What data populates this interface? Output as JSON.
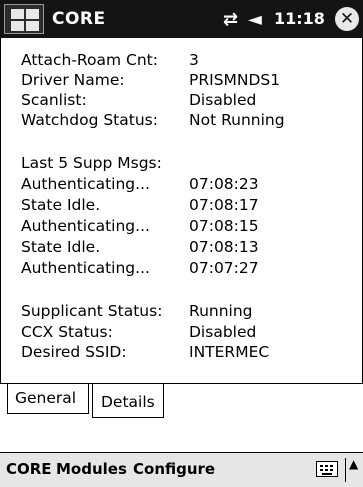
{
  "titlebar": {
    "title": "CORE",
    "time": "11:18",
    "icons": [
      "start-menu-icon",
      "connectivity-icon",
      "volume-icon",
      "close-icon"
    ]
  },
  "details": {
    "rows": [
      {
        "label": "Attach-Roam Cnt:",
        "value": "3"
      },
      {
        "label": "Driver Name:",
        "value": "PRISMNDS1"
      },
      {
        "label": "Scanlist:",
        "value": "Disabled"
      },
      {
        "label": "Watchdog Status:",
        "value": "Not Running"
      },
      {
        "label": "Last 5 Supp Msgs:",
        "value": ""
      },
      {
        "label": "Authenticating...",
        "value": "07:08:23"
      },
      {
        "label": "State Idle.",
        "value": "07:08:17"
      },
      {
        "label": "Authenticating...",
        "value": "07:08:15"
      },
      {
        "label": "State Idle.",
        "value": "07:08:13"
      },
      {
        "label": "Authenticating...",
        "value": "07:07:27"
      },
      {
        "label": "Supplicant Status:",
        "value": "Running"
      },
      {
        "label": "CCX Status:",
        "value": "Disabled"
      },
      {
        "label": "Desired SSID:",
        "value": "INTERMEC"
      }
    ]
  },
  "tabs": [
    {
      "label": "General",
      "active": false
    },
    {
      "label": "Details",
      "active": true
    }
  ],
  "menubar": {
    "items": [
      "CORE",
      "Modules",
      "Configure"
    ],
    "icons": [
      "keyboard-icon",
      "up-arrow-icon"
    ]
  }
}
